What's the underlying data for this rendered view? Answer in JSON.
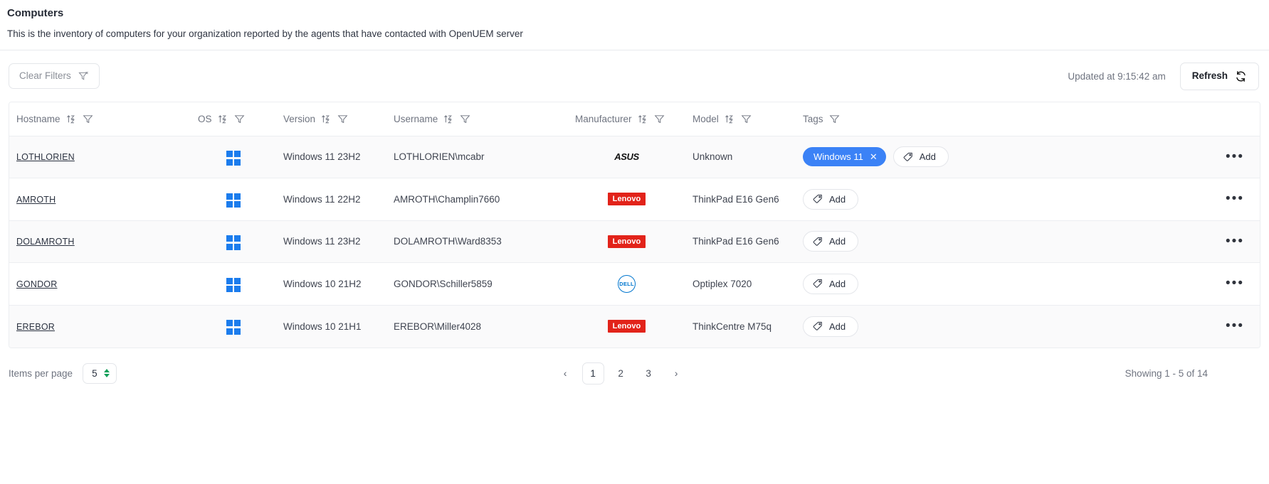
{
  "header": {
    "title": "Computers",
    "subtitle": "This is the inventory of computers for your organization reported by the agents that have contacted with OpenUEM server"
  },
  "toolbar": {
    "clear_filters_label": "Clear Filters",
    "clear_filters_icon": "filter-clear-icon",
    "updated_text": "Updated at 9:15:42 am",
    "refresh_label": "Refresh",
    "refresh_icon": "refresh-icon"
  },
  "table": {
    "columns": [
      {
        "key": "hostname",
        "label": "Hostname",
        "sortable": true,
        "filterable": true
      },
      {
        "key": "os",
        "label": "OS",
        "sortable": true,
        "filterable": true
      },
      {
        "key": "version",
        "label": "Version",
        "sortable": true,
        "filterable": true
      },
      {
        "key": "username",
        "label": "Username",
        "sortable": true,
        "filterable": true
      },
      {
        "key": "manufacturer",
        "label": "Manufacturer",
        "sortable": true,
        "filterable": true
      },
      {
        "key": "model",
        "label": "Model",
        "sortable": true,
        "filterable": true
      },
      {
        "key": "tags",
        "label": "Tags",
        "sortable": false,
        "filterable": true
      }
    ],
    "add_tag_label": "Add",
    "row_menu_label": "•••",
    "rows": [
      {
        "hostname": "LOTHLORIEN",
        "os_icon": "windows-logo-icon",
        "version": "Windows 11 23H2",
        "username": "LOTHLORIEN\\mcabr",
        "manufacturer": "ASUS",
        "manufacturer_logo": "asus-logo-icon",
        "model": "Unknown",
        "tags": [
          "Windows 11"
        ]
      },
      {
        "hostname": "AMROTH",
        "os_icon": "windows-logo-icon",
        "version": "Windows 11 22H2",
        "username": "AMROTH\\Champlin7660",
        "manufacturer": "Lenovo",
        "manufacturer_logo": "lenovo-logo-icon",
        "model": "ThinkPad E16 Gen6",
        "tags": []
      },
      {
        "hostname": "DOLAMROTH",
        "os_icon": "windows-logo-icon",
        "version": "Windows 11 23H2",
        "username": "DOLAMROTH\\Ward8353",
        "manufacturer": "Lenovo",
        "manufacturer_logo": "lenovo-logo-icon",
        "model": "ThinkPad E16 Gen6",
        "tags": []
      },
      {
        "hostname": "GONDOR",
        "os_icon": "windows-logo-icon",
        "version": "Windows 10 21H2",
        "username": "GONDOR\\Schiller5859",
        "manufacturer": "DELL",
        "manufacturer_logo": "dell-logo-icon",
        "model": "Optiplex 7020",
        "tags": []
      },
      {
        "hostname": "EREBOR",
        "os_icon": "windows-logo-icon",
        "version": "Windows 10 21H1",
        "username": "EREBOR\\Miller4028",
        "manufacturer": "Lenovo",
        "manufacturer_logo": "lenovo-logo-icon",
        "model": "ThinkCentre M75q",
        "tags": []
      }
    ]
  },
  "footer": {
    "items_per_page_label": "Items per page",
    "items_per_page_value": "5",
    "pages": [
      "1",
      "2",
      "3"
    ],
    "active_page": "1",
    "prev_label": "‹",
    "next_label": "›",
    "showing_text": "Showing 1 - 5 of 14"
  },
  "colors": {
    "accent": "#3b82f6",
    "windows_blue": "#1b7ced",
    "lenovo_red": "#e2231a",
    "dell_blue": "#0076ce",
    "spinner_green": "#14a05a"
  }
}
